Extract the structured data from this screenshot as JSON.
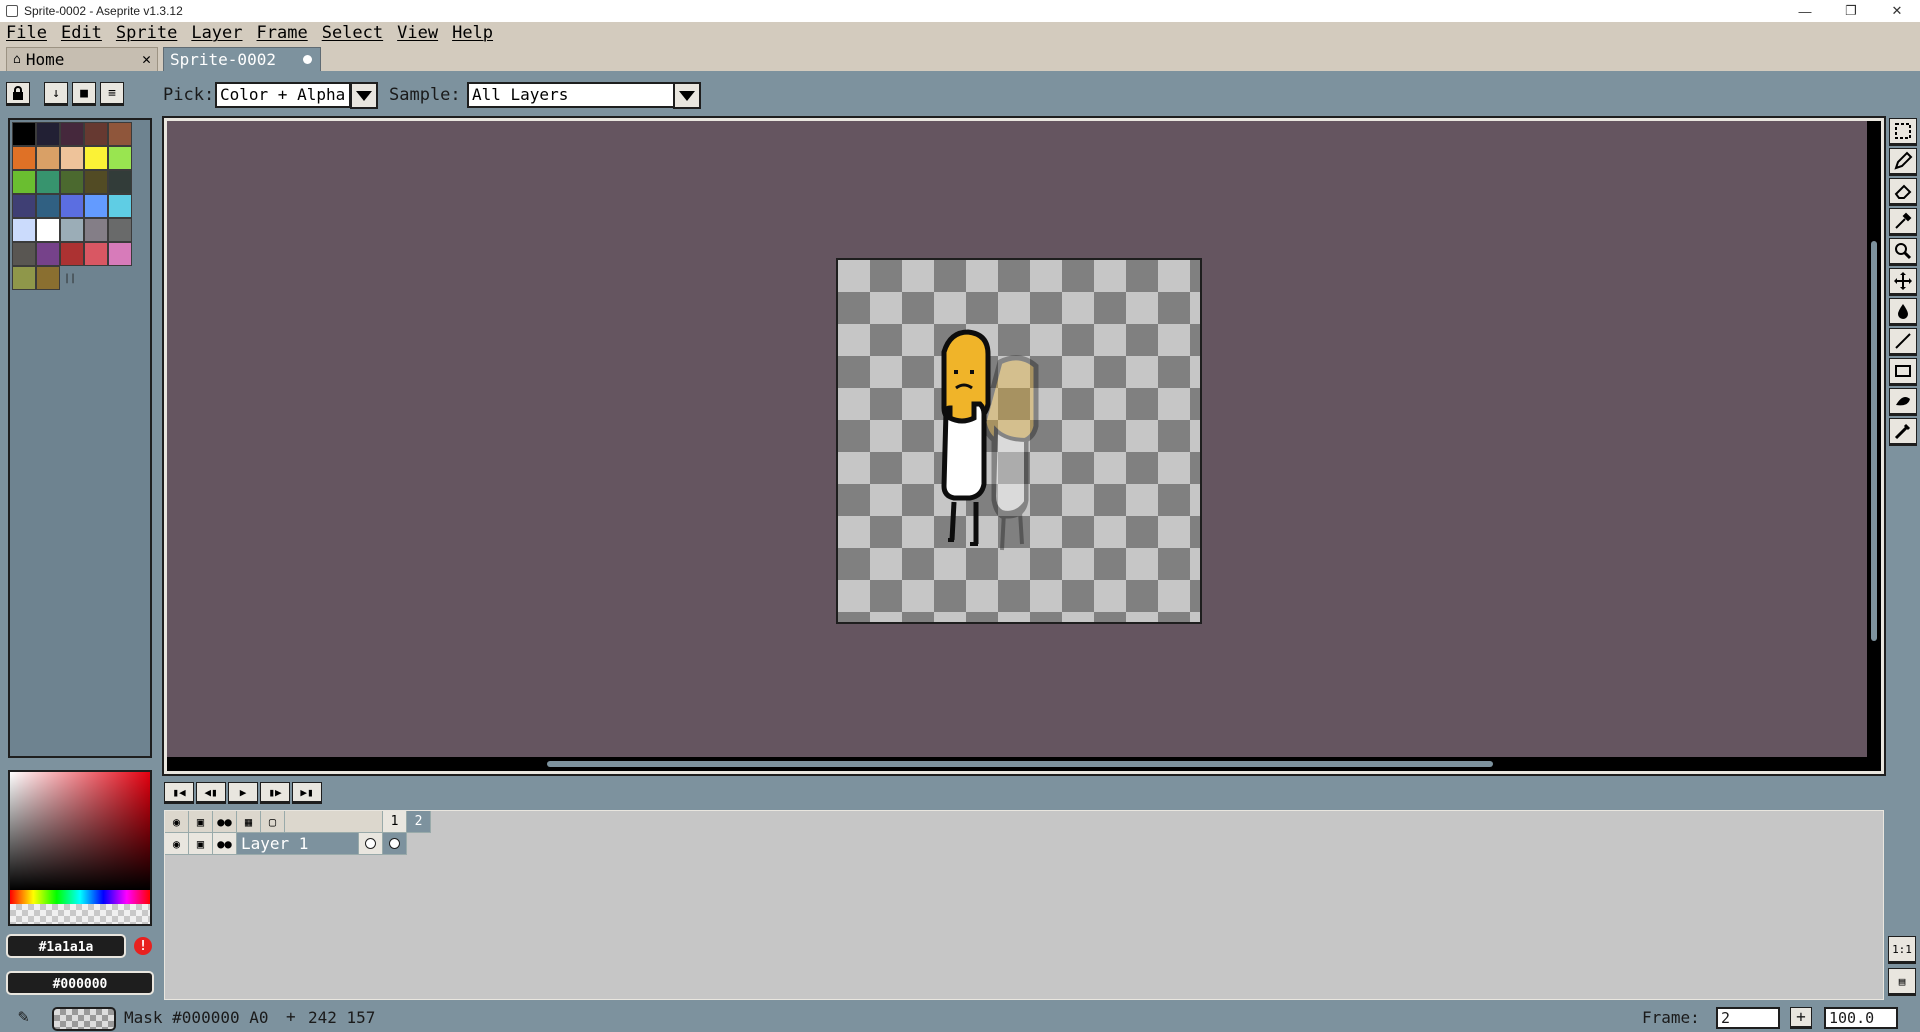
{
  "window": {
    "title": "Sprite-0002 - Aseprite v1.3.12",
    "minimize": "—",
    "maximize": "❐",
    "close": "✕"
  },
  "menu": [
    "File",
    "Edit",
    "Sprite",
    "Layer",
    "Frame",
    "Select",
    "View",
    "Help"
  ],
  "tabs": {
    "home": {
      "label": "Home",
      "close": "✕"
    },
    "sprite": {
      "label": "Sprite-0002"
    }
  },
  "context_bar": {
    "pick_label": "Pick:",
    "pick_value": "Color + Alpha",
    "sample_label": "Sample:",
    "sample_value": "All Layers"
  },
  "palette": {
    "colors": [
      "#000000",
      "#222034",
      "#45283c",
      "#663931",
      "#8f563b",
      "#df7126",
      "#d9a066",
      "#eec39a",
      "#fbf236",
      "#99e550",
      "#6abe30",
      "#37946e",
      "#4b692f",
      "#524b24",
      "#323c39",
      "#3f3f74",
      "#306082",
      "#5b6ee1",
      "#639bff",
      "#5fcde4",
      "#cbdbfc",
      "#ffffff",
      "#9badb7",
      "#847e87",
      "#696a6a",
      "#595652",
      "#76428a",
      "#ac3232",
      "#d95763",
      "#d77bba",
      "#8f974a",
      "#8a6f30"
    ]
  },
  "color": {
    "foreground": "#1a1a1a",
    "background": "#000000",
    "warning": "!"
  },
  "sprite": {
    "checker_dark": "#808080",
    "checker_light": "#c6c6c6",
    "body_color": "#f0b429",
    "dress_color": "#ffffff",
    "outline_color": "#0d0d0d"
  },
  "timeline": {
    "layers": [
      {
        "name": "Layer 1"
      }
    ],
    "frames": [
      "1",
      "2"
    ],
    "current_frame": "2"
  },
  "status": {
    "mask": "Mask #000000 A0",
    "coords": "242 157",
    "frame_label": "Frame:",
    "frame_value": "2",
    "zoom_value": "100.0"
  }
}
